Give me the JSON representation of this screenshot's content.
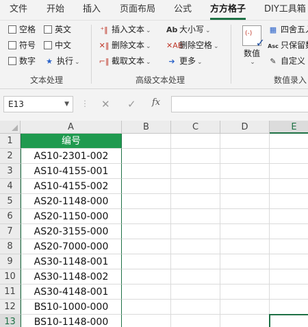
{
  "tabs": [
    {
      "label": "文件",
      "active": false
    },
    {
      "label": "开始",
      "active": false
    },
    {
      "label": "插入",
      "active": false
    },
    {
      "label": "页面布局",
      "active": false
    },
    {
      "label": "公式",
      "active": false
    },
    {
      "label": "方方格子",
      "active": true
    },
    {
      "label": "DIY工具箱",
      "active": false
    }
  ],
  "ribbon": {
    "text_group": {
      "label": "文本处理",
      "checkboxes": [
        "空格",
        "英文",
        "符号",
        "中文",
        "数字"
      ],
      "execute": "执行"
    },
    "adv_group": {
      "label": "高级文本处理",
      "insert": "插入文本",
      "delete": "删除文本",
      "extract": "截取文本",
      "case": "大小写",
      "delete_space": "删除空格",
      "more": "更多"
    },
    "num_group": {
      "label": "数值录入",
      "value_button": "数值",
      "round": "四舍五入",
      "keep": "只保留数",
      "custom": "自定义"
    }
  },
  "formula_bar": {
    "name_box": "E13",
    "fx_label": "fx",
    "formula": ""
  },
  "grid": {
    "columns": [
      "A",
      "B",
      "C",
      "D",
      "E"
    ],
    "selected_column": "E",
    "rows": [
      "1",
      "2",
      "3",
      "4",
      "5",
      "6",
      "7",
      "8",
      "9",
      "10",
      "11",
      "12",
      "13"
    ],
    "selected_row": "13",
    "column_a": [
      "编号",
      "AS10-2301-002",
      "AS10-4155-001",
      "AS10-4155-002",
      "AS20-1148-000",
      "AS20-1150-000",
      "AS20-3155-000",
      "AS20-7000-000",
      "AS30-1148-001",
      "AS30-1148-002",
      "AS30-4148-001",
      "BS10-1000-000",
      "BS10-1148-000"
    ],
    "active_cell": "E13",
    "header_fill": "#1f9a4f",
    "accent": "#1e7145"
  }
}
